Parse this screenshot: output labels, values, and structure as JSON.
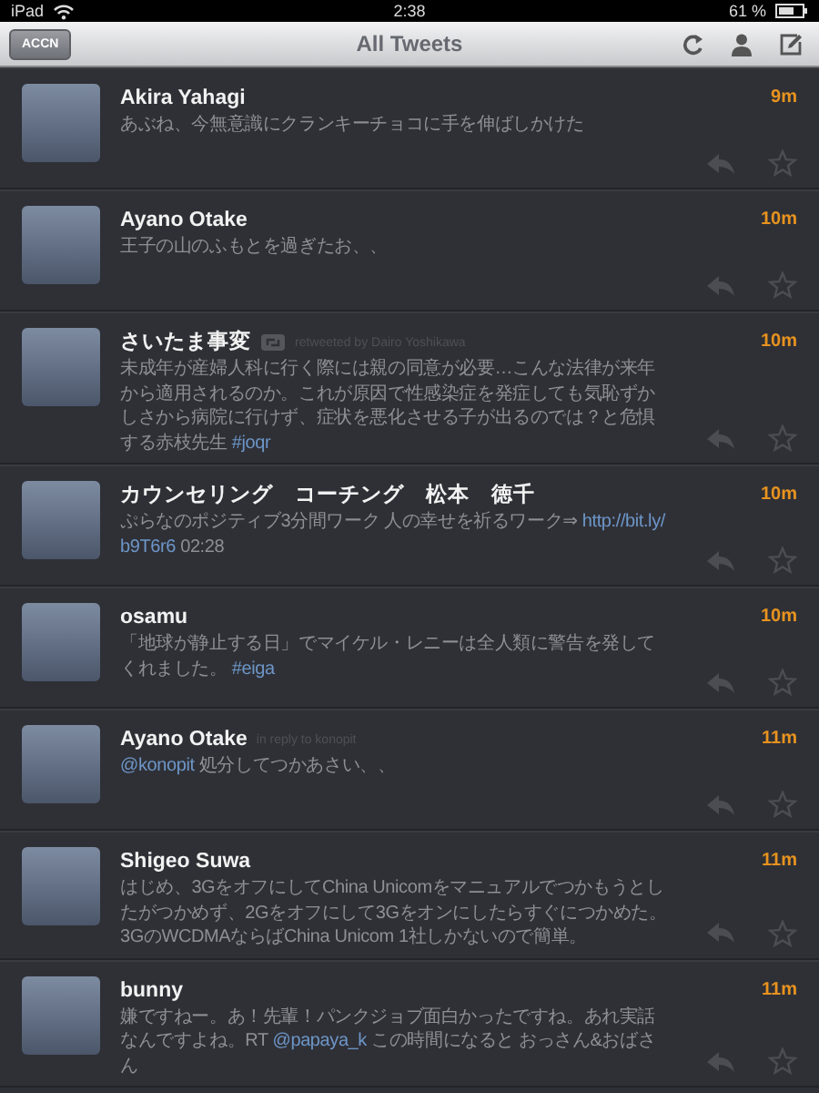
{
  "status_bar": {
    "device": "iPad",
    "time": "2:38",
    "battery": "61 %"
  },
  "nav": {
    "account_button": "ACCN",
    "title": "All Tweets"
  },
  "tweets": [
    {
      "name": "Akira Yahagi",
      "time": "9m",
      "actions": true,
      "body": [
        {
          "kind": "plain",
          "text": "あぶね、今無意識にクランキーチョコに手を伸ばしかけた"
        }
      ]
    },
    {
      "name": "Ayano Otake",
      "time": "10m",
      "actions": true,
      "body": [
        {
          "kind": "plain",
          "text": "王子の山のふもとを過ぎたお、、"
        }
      ]
    },
    {
      "name": "さいたま事変",
      "time": "10m",
      "actions": true,
      "meta": {
        "kind": "retweet",
        "text": "retweeted by Dairo Yoshikawa"
      },
      "body": [
        {
          "kind": "plain",
          "text": "未成年が産婦人科に行く際には親の同意が必要…こんな法律が来年から適用されるのか。これが原因で性感染症を発症しても気恥ずかしさから病院に行けず、症状を悪化させる子が出るのでは？と危惧する赤枝先生 "
        },
        {
          "kind": "link",
          "text": "#joqr"
        }
      ]
    },
    {
      "name": "カウンセリング　コーチング　松本　徳千",
      "time": "10m",
      "actions": true,
      "body": [
        {
          "kind": "plain",
          "text": "ぷらなのポジティブ3分間ワーク 人の幸せを祈るワーク⇒ "
        },
        {
          "kind": "link",
          "text": "http://bit.ly/"
        },
        {
          "kind": "link",
          "text": "b9T6r6"
        },
        {
          "kind": "plain",
          "text": " 02:28"
        }
      ]
    },
    {
      "name": "osamu",
      "time": "10m",
      "actions": true,
      "body": [
        {
          "kind": "plain",
          "text": "「地球が静止する日」でマイケル・レニーは全人類に警告を発してくれました。 "
        },
        {
          "kind": "link",
          "text": "#eiga"
        }
      ]
    },
    {
      "name": "Ayano Otake",
      "time": "11m",
      "actions": true,
      "meta": {
        "kind": "reply",
        "text": "in reply to konopit"
      },
      "body": [
        {
          "kind": "link",
          "text": "@konopit"
        },
        {
          "kind": "plain",
          "text": " 処分してつかあさい、、"
        }
      ]
    },
    {
      "name": "Shigeo Suwa",
      "time": "11m",
      "actions": true,
      "body": [
        {
          "kind": "plain",
          "text": "はじめ、3GをオフにしてChina Unicomをマニュアルでつかもうとしたがつかめず、2Gをオフにして3Gをオンにしたらすぐにつかめた。3GのWCDMAならばChina Unicom 1社しかないので簡単。"
        }
      ]
    },
    {
      "name": "bunny",
      "time": "11m",
      "actions": true,
      "body": [
        {
          "kind": "plain",
          "text": "嫌ですねー。あ！先輩！パンクジョブ面白かったですね。あれ実話なんですよね。RT "
        },
        {
          "kind": "link",
          "text": "@papaya_k"
        },
        {
          "kind": "plain",
          "text": " この時間になると おっさん&おばさん"
        }
      ]
    }
  ]
}
